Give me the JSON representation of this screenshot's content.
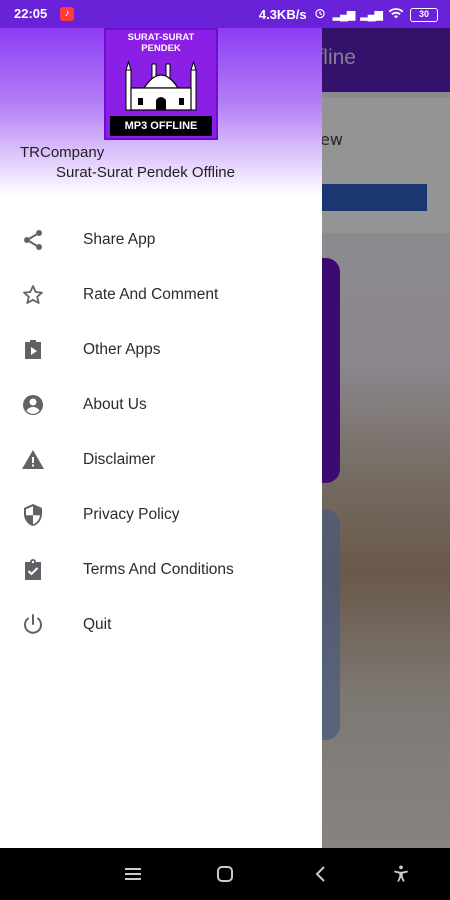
{
  "status_bar": {
    "time": "22:05",
    "app_icon": "tiktok-icon",
    "network_speed": "4.3KB/s",
    "signal_1": "▂▄▆",
    "signal_2": "▂▄▆",
    "battery": "30"
  },
  "background_app": {
    "title": "ffline",
    "card_text": "ew"
  },
  "drawer": {
    "logo": {
      "top_text_1": "SURAT-SURAT",
      "top_text_2": "PENDEK",
      "bottom_text": "MP3 OFFLINE"
    },
    "company": "TRCompany",
    "app_name": "Surat-Surat Pendek Offline",
    "menu": [
      {
        "label": "Share App",
        "icon": "share-icon"
      },
      {
        "label": "Rate And Comment",
        "icon": "star-icon"
      },
      {
        "label": "Other Apps",
        "icon": "play-store-icon"
      },
      {
        "label": "About Us",
        "icon": "account-circle-icon"
      },
      {
        "label": "Disclaimer",
        "icon": "warning-icon"
      },
      {
        "label": "Privacy Policy",
        "icon": "shield-icon"
      },
      {
        "label": "Terms And Conditions",
        "icon": "clipboard-check-icon"
      },
      {
        "label": "Quit",
        "icon": "power-icon"
      }
    ]
  },
  "colors": {
    "primary": "#6a22d8",
    "logo_bg": "#8b1fe6",
    "text": "#2b2b2b",
    "icon": "#5f6368"
  }
}
